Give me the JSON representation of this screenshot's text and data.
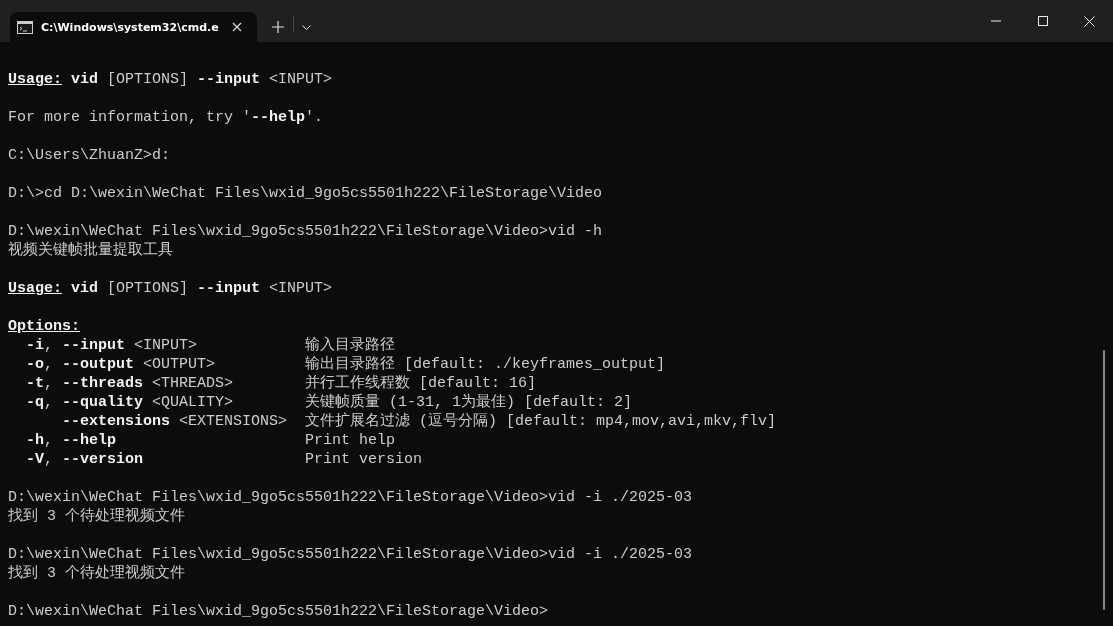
{
  "window": {
    "tab_title": "C:\\Windows\\system32\\cmd.e",
    "tab_selected": true
  },
  "lines": [
    {
      "kind": "usage",
      "label": "Usage:",
      "text": "**vid** [OPTIONS] **--input** <INPUT>"
    },
    {
      "kind": "blank"
    },
    {
      "kind": "text",
      "text": "For more information, try '**--help**'."
    },
    {
      "kind": "blank"
    },
    {
      "kind": "text",
      "text": "C:\\Users\\ZhuanZ>d:"
    },
    {
      "kind": "blank"
    },
    {
      "kind": "text",
      "text": "D:\\>cd D:\\wexin\\WeChat Files\\wxid_9go5cs5501h222\\FileStorage\\Video"
    },
    {
      "kind": "blank"
    },
    {
      "kind": "text",
      "text": "D:\\wexin\\WeChat Files\\wxid_9go5cs5501h222\\FileStorage\\Video>vid -h"
    },
    {
      "kind": "text",
      "text": "视频关键帧批量提取工具"
    },
    {
      "kind": "blank"
    },
    {
      "kind": "usage",
      "label": "Usage:",
      "text": "**vid** [OPTIONS] **--input** <INPUT>"
    },
    {
      "kind": "blank"
    },
    {
      "kind": "heading",
      "label": "Options:"
    },
    {
      "kind": "option",
      "flag": "**-i**, **--input** <INPUT>",
      "description": "输入目录路径"
    },
    {
      "kind": "option",
      "flag": "**-o**, **--output** <OUTPUT>",
      "description": "输出目录路径 [default: ./keyframes_output]"
    },
    {
      "kind": "option",
      "flag": "**-t**, **--threads** <THREADS>",
      "description": "并行工作线程数 [default: 16]"
    },
    {
      "kind": "option",
      "flag": "**-q**, **--quality** <QUALITY>",
      "description": "关键帧质量 (1-31, 1为最佳) [default: 2]"
    },
    {
      "kind": "option",
      "flag": "    **--extensions** <EXTENSIONS>",
      "description": "文件扩展名过滤 (逗号分隔) [default: mp4,mov,avi,mkv,flv]"
    },
    {
      "kind": "option",
      "flag": "**-h**, **--help**",
      "description": "Print help"
    },
    {
      "kind": "option",
      "flag": "**-V**, **--version**",
      "description": "Print version"
    },
    {
      "kind": "blank"
    },
    {
      "kind": "text",
      "text": "D:\\wexin\\WeChat Files\\wxid_9go5cs5501h222\\FileStorage\\Video>vid -i ./2025-03"
    },
    {
      "kind": "text",
      "text": "找到 3 个待处理视频文件"
    },
    {
      "kind": "blank"
    },
    {
      "kind": "text",
      "text": "D:\\wexin\\WeChat Files\\wxid_9go5cs5501h222\\FileStorage\\Video>vid -i ./2025-03"
    },
    {
      "kind": "text",
      "text": "找到 3 个待处理视频文件"
    },
    {
      "kind": "blank"
    },
    {
      "kind": "text",
      "text": "D:\\wexin\\WeChat Files\\wxid_9go5cs5501h222\\FileStorage\\Video>"
    }
  ]
}
